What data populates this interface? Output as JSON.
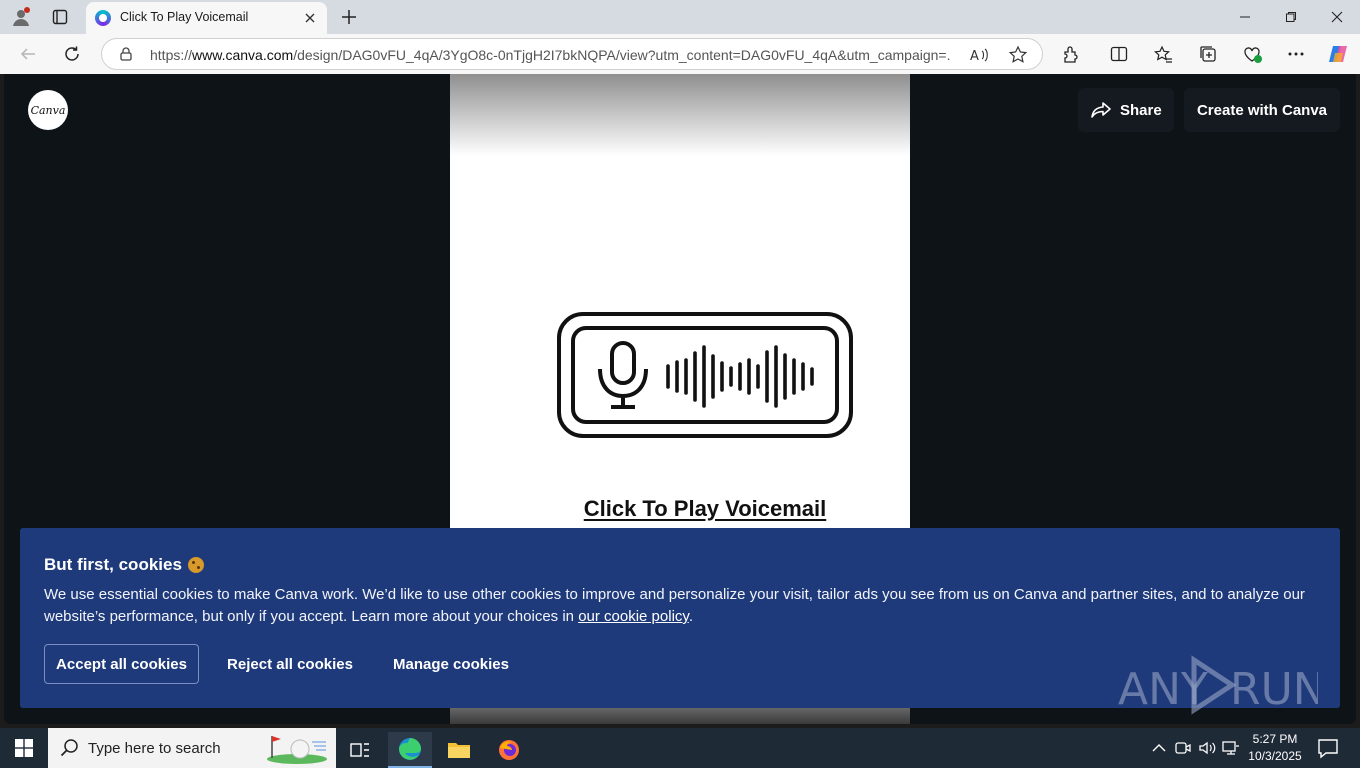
{
  "browser": {
    "tab_title": "Click To Play Voicemail",
    "url_prefix": "https://",
    "url_domain": "www.canva.com",
    "url_rest": "/design/DAG0vFU_4qA/3YgO8c-0nTjgH2I7bkNQPA/view?utm_content=DAG0vFU_4qA&utm_campaign=..."
  },
  "canva": {
    "logo_text": "Canva",
    "share_label": "Share",
    "create_label": "Create with Canva",
    "voicemail_link": "Click To Play Voicemail"
  },
  "cookie_banner": {
    "title": "But first, cookies",
    "body_text": "We use essential cookies to make Canva work. We’d like to use other cookies to improve and personalize your visit, tailor ads you see from us on Canva and partner sites, and to analyze our website’s performance, but only if you accept. Learn more about your choices in ",
    "policy_link": "our cookie policy",
    "body_end": ".",
    "accept_label": "Accept all cookies",
    "reject_label": "Reject all cookies",
    "manage_label": "Manage cookies"
  },
  "watermark": {
    "left": "ANY",
    "right": "RUN"
  },
  "taskbar": {
    "search_placeholder": "Type here to search",
    "time": "5:27 PM",
    "date": "10/3/2025"
  },
  "colors": {
    "banner": "#1f3a7a",
    "viewer_bg": "#0e1318",
    "taskbar": "#1f2a37"
  }
}
